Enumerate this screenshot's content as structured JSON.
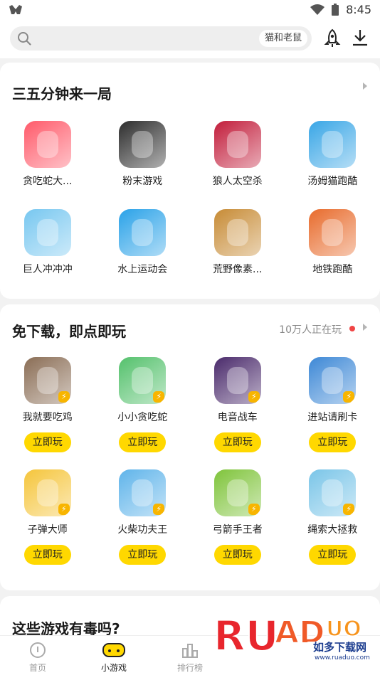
{
  "status_bar": {
    "time": "8:45",
    "left_icon": "app-logo-icon",
    "icons": [
      "wifi-icon",
      "battery-icon"
    ]
  },
  "search": {
    "placeholder": "",
    "hint": "猫和老鼠"
  },
  "header_icons": [
    "rocket-icon",
    "download-icon"
  ],
  "section1": {
    "title": "三五分钟来一局",
    "games": [
      {
        "name": "贪吃蛇大...",
        "color": "#ff5a6a",
        "icon": "snake-game-icon"
      },
      {
        "name": "粉末游戏",
        "color": "#2d2d2d",
        "icon": "powder-game-icon"
      },
      {
        "name": "狼人太空杀",
        "color": "#c21d3b",
        "icon": "among-us-icon"
      },
      {
        "name": "汤姆猫跑酷",
        "color": "#39a6e6",
        "icon": "tom-cat-icon"
      },
      {
        "name": "巨人冲冲冲",
        "color": "#77c7f0",
        "icon": "giant-rush-icon"
      },
      {
        "name": "水上运动会",
        "color": "#2aa2e8",
        "icon": "water-race-icon"
      },
      {
        "name": "荒野像素...",
        "color": "#c78b35",
        "icon": "pixel-shooter-icon"
      },
      {
        "name": "地铁跑酷",
        "color": "#e86b2c",
        "icon": "subway-surfer-icon"
      }
    ]
  },
  "section2": {
    "title": "免下载，即点即玩",
    "online": "10万人正在玩",
    "play_label": "立即玩",
    "games": [
      {
        "name": "我就要吃鸡",
        "color": "#8a6d55",
        "icon": "gun-game-icon"
      },
      {
        "name": "小小贪吃蛇",
        "color": "#54c16c",
        "icon": "little-snake-icon"
      },
      {
        "name": "电音战车",
        "color": "#4a2a6b",
        "icon": "music-car-icon"
      },
      {
        "name": "进站请刷卡",
        "color": "#3d88d6",
        "icon": "train-icon"
      },
      {
        "name": "子弹大师",
        "color": "#f5c53b",
        "icon": "bullet-master-icon"
      },
      {
        "name": "火柴功夫王",
        "color": "#5fb4ea",
        "icon": "stickman-kungfu-icon"
      },
      {
        "name": "弓箭手王者",
        "color": "#7fc43b",
        "icon": "archer-icon"
      },
      {
        "name": "绳索大拯救",
        "color": "#7ac5e8",
        "icon": "rope-rescue-icon"
      }
    ]
  },
  "section3": {
    "title": "这些游戏有毒吗?"
  },
  "tabs": [
    {
      "label": "首页",
      "icon": "home-icon",
      "active": false
    },
    {
      "label": "小游戏",
      "icon": "gamepad-icon",
      "active": true
    },
    {
      "label": "排行榜",
      "icon": "ranking-icon",
      "active": false
    }
  ],
  "watermark": {
    "logo": "RUANDUO",
    "text": "如多下载网",
    "url": "www.ruaduo.com"
  }
}
